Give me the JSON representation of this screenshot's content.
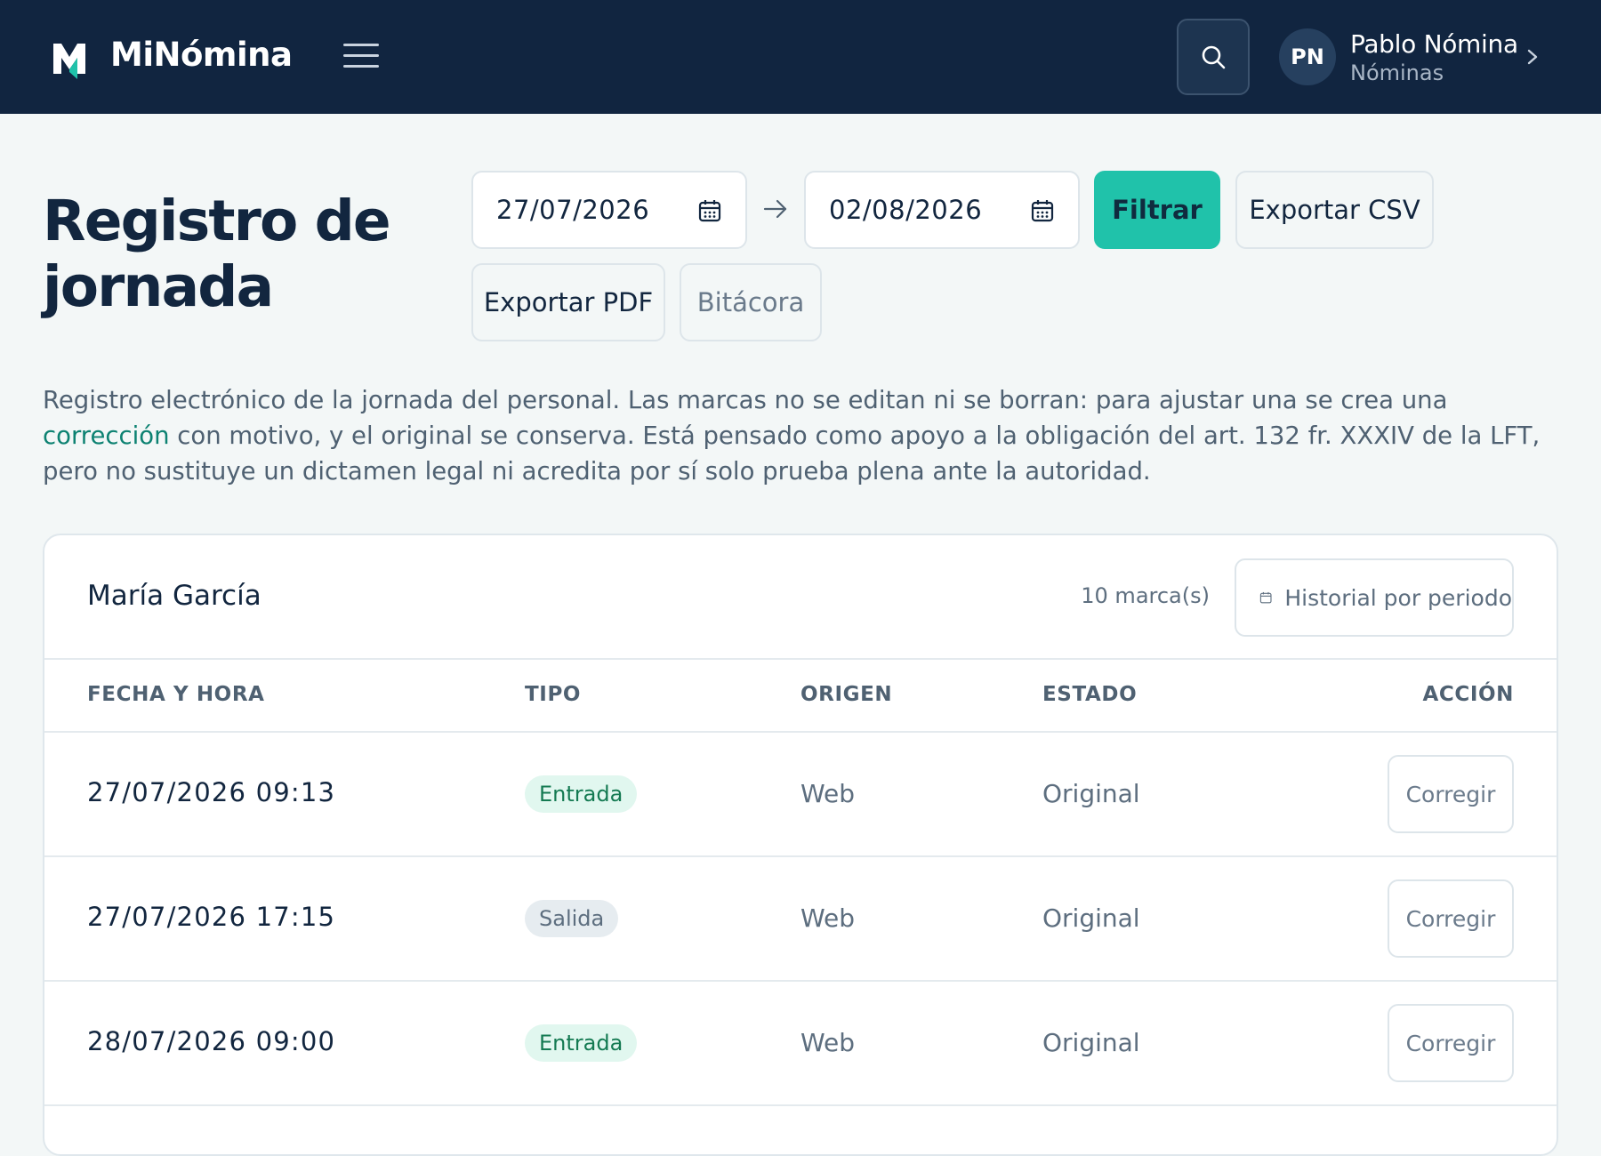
{
  "app": {
    "name": "MiNómina"
  },
  "user": {
    "initials": "PN",
    "name": "Pablo Nómina",
    "role": "Nóminas"
  },
  "page": {
    "title": "Registro de jornada",
    "intro_before": "Registro electrónico de la jornada del personal. Las marcas no se editan ni se borran: para ajustar una se crea una ",
    "intro_link": "corrección",
    "intro_after": " con motivo, y el original se conserva. Está pensado como apoyo a la obligación del art. 132 fr. XXXIV de la LFT, pero no sustituye un dictamen legal ni acredita por sí solo prueba plena ante la autoridad."
  },
  "filters": {
    "date_from": "27/07/2026",
    "date_to": "02/08/2026",
    "filter_label": "Filtrar",
    "export_csv_label": "Exportar CSV",
    "export_pdf_label": "Exportar PDF",
    "log_label": "Bitácora"
  },
  "card": {
    "employee": "María García",
    "count_label": "10 marca(s)",
    "history_label": "Historial por periodo",
    "columns": [
      "FECHA Y HORA",
      "TIPO",
      "ORIGEN",
      "ESTADO",
      "ACCIÓN"
    ],
    "rows": [
      {
        "datetime": "27/07/2026 09:13",
        "type": "Entrada",
        "origin": "Web",
        "state": "Original",
        "action": "Corregir"
      },
      {
        "datetime": "27/07/2026 17:15",
        "type": "Salida",
        "origin": "Web",
        "state": "Original",
        "action": "Corregir"
      },
      {
        "datetime": "28/07/2026 09:00",
        "type": "Entrada",
        "origin": "Web",
        "state": "Original",
        "action": "Corregir"
      }
    ]
  },
  "colors": {
    "topbar": "#112540",
    "accent": "#20c2aa",
    "background": "#f3f7f7",
    "link": "#0d8272",
    "pill_in_bg": "#e1f7ef",
    "pill_in_text": "#147a52",
    "pill_out_bg": "#e6ecf0"
  },
  "icons": [
    "logo-icon",
    "menu-icon",
    "search-icon",
    "chevron-right-icon",
    "calendar-icon",
    "arrow-right-icon"
  ]
}
